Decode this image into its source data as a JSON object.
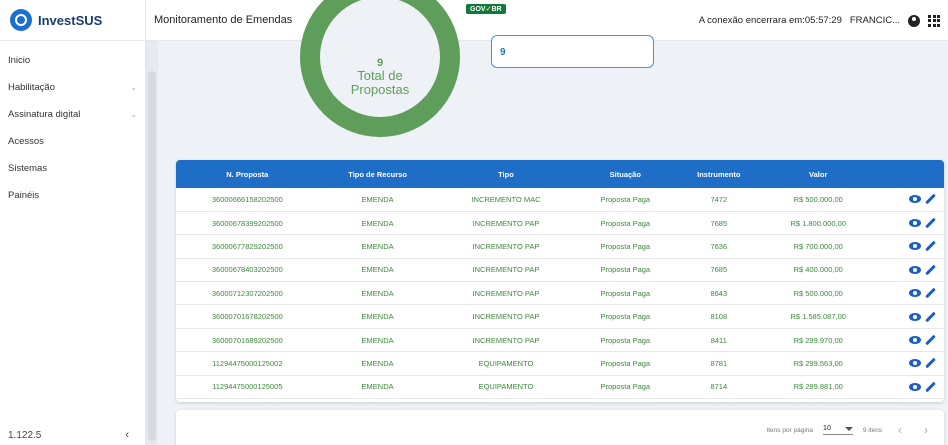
{
  "app": {
    "name": "InvestSUS",
    "version": "1.122.5"
  },
  "sidebar": {
    "items": [
      {
        "label": "Inicio",
        "has_children": false
      },
      {
        "label": "Habilitação",
        "has_children": true
      },
      {
        "label": "Assinatura digital",
        "has_children": true
      },
      {
        "label": "Acessos",
        "has_children": false
      },
      {
        "label": "Sistemas",
        "has_children": false
      },
      {
        "label": "Painéis",
        "has_children": false
      }
    ],
    "collapse_glyph": "‹"
  },
  "header": {
    "title": "Monitoramento de Emendas",
    "gov_badge": "GOV.BR",
    "session_text": "A conexão encerrara em:",
    "session_time": "05:57:29",
    "user": "FRANCIC..."
  },
  "summary": {
    "donut_value": "9",
    "donut_label": "Total de Propostas",
    "card_value": "9"
  },
  "table": {
    "headers": [
      "N. Proposta",
      "Tipo de Recurso",
      "Tipo",
      "Situação",
      "Instrumento",
      "Valor"
    ],
    "rows": [
      [
        "36000666158202500",
        "EMENDA",
        "INCREMENTO MAC",
        "Proposta Paga",
        "7472",
        "R$ 500.000,00"
      ],
      [
        "36000678399202500",
        "EMENDA",
        "INCREMENTO PAP",
        "Proposta Paga",
        "7685",
        "R$ 1.800.000,00"
      ],
      [
        "36000677829202500",
        "EMENDA",
        "INCREMENTO PAP",
        "Proposta Paga",
        "7636",
        "R$ 700.000,00"
      ],
      [
        "36000678403202500",
        "EMENDA",
        "INCREMENTO PAP",
        "Proposta Paga",
        "7685",
        "R$ 400.000,00"
      ],
      [
        "36000712307202500",
        "EMENDA",
        "INCREMENTO PAP",
        "Proposta Paga",
        "8643",
        "R$ 500.000,00"
      ],
      [
        "36000701678202500",
        "EMENDA",
        "INCREMENTO PAP",
        "Proposta Paga",
        "8108",
        "R$ 1.585.087,00"
      ],
      [
        "36000701689202500",
        "EMENDA",
        "INCREMENTO PAP",
        "Proposta Paga",
        "8411",
        "R$ 299.970,00"
      ],
      [
        "11294475000125002",
        "EMENDA",
        "EQUIPAMENTO",
        "Proposta Paga",
        "8781",
        "R$ 299.563,00"
      ],
      [
        "11294475000125005",
        "EMENDA",
        "EQUIPAMENTO",
        "Proposta Paga",
        "8714",
        "R$ 299.881,00"
      ]
    ]
  },
  "paginator": {
    "items_per_page_label": "Itens por página",
    "items_per_page_value": "10",
    "range_label": "9 itens",
    "prev": "‹",
    "next": "›"
  }
}
